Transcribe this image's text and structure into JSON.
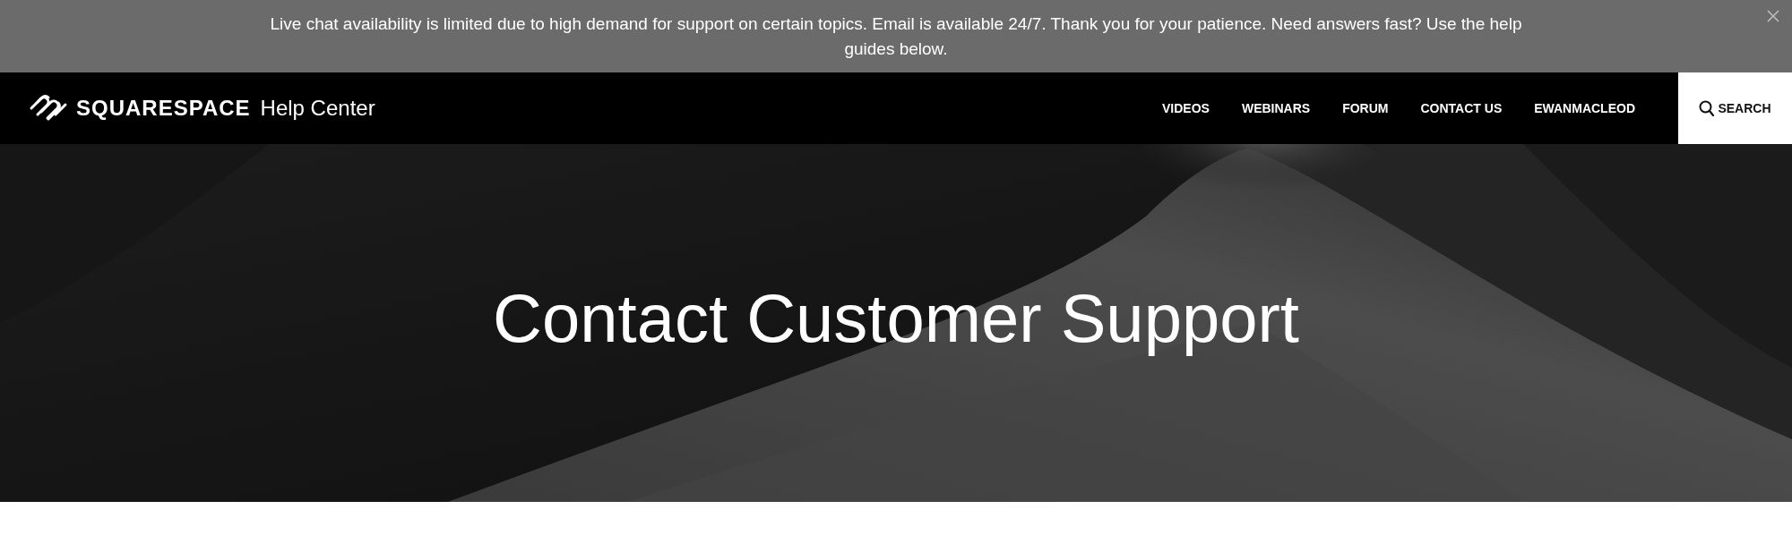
{
  "banner": {
    "message": "Live chat availability is limited due to high demand for support on certain topics. Email is available 24/7. Thank you for your patience. Need answers fast? Use the help guides below."
  },
  "header": {
    "brand": "SQUARESPACE",
    "product": "Help Center",
    "nav": [
      {
        "label": "VIDEOS"
      },
      {
        "label": "WEBINARS"
      },
      {
        "label": "FORUM"
      },
      {
        "label": "CONTACT US"
      },
      {
        "label": "EWANMACLEOD"
      }
    ],
    "search": {
      "label": "SEARCH"
    }
  },
  "hero": {
    "kind": "picture",
    "title": "Contact Customer Support"
  }
}
